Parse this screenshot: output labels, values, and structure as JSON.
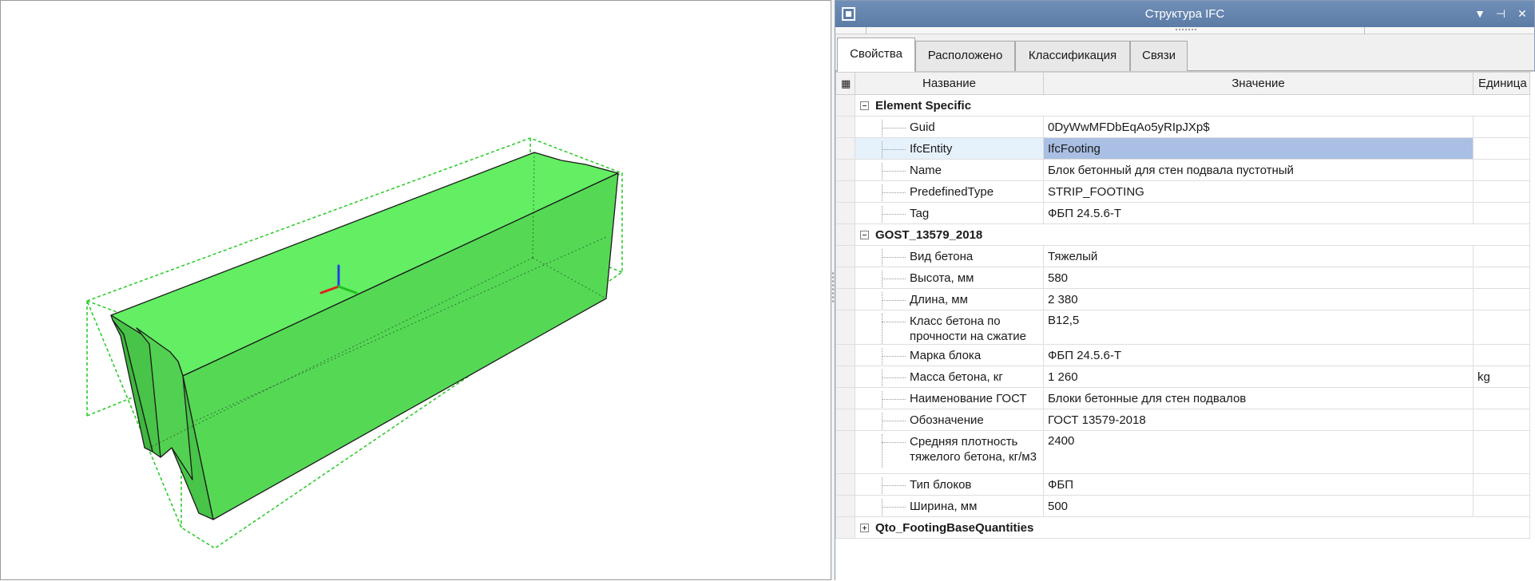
{
  "panel": {
    "title": "Структура IFC",
    "tabs": [
      "Свойства",
      "Расположено",
      "Классификация",
      "Связи"
    ],
    "active_tab": 0
  },
  "grid": {
    "columns": {
      "name": "Название",
      "value": "Значение",
      "unit": "Единица"
    },
    "groups": [
      {
        "name": "Element Specific",
        "expanded": true,
        "rows": [
          {
            "name": "Guid",
            "value": "0DyWwMFDbEqAo5yRIpJXp$",
            "unit": ""
          },
          {
            "name": "IfcEntity",
            "value": "IfcFooting",
            "unit": "",
            "selected": true
          },
          {
            "name": "Name",
            "value": "Блок бетонный для стен подвала пустотный",
            "unit": ""
          },
          {
            "name": "PredefinedType",
            "value": "STRIP_FOOTING",
            "unit": ""
          },
          {
            "name": "Tag",
            "value": "ФБП 24.5.6-Т",
            "unit": ""
          }
        ]
      },
      {
        "name": "GOST_13579_2018",
        "expanded": true,
        "rows": [
          {
            "name": "Вид бетона",
            "value": "Тяжелый",
            "unit": ""
          },
          {
            "name": "Высота, мм",
            "value": "580",
            "unit": ""
          },
          {
            "name": "Длина, мм",
            "value": "2 380",
            "unit": ""
          },
          {
            "name": "Класс бетона по прочности на сжатие",
            "value": "В12,5",
            "unit": ""
          },
          {
            "name": "Марка блока",
            "value": "ФБП 24.5.6-Т",
            "unit": ""
          },
          {
            "name": "Масса бетона, кг",
            "value": "1 260",
            "unit": "kg"
          },
          {
            "name": "Наименование ГОСТ",
            "value": "Блоки бетонные для стен подвалов",
            "unit": ""
          },
          {
            "name": "Обозначение",
            "value": "ГОСТ 13579-2018",
            "unit": ""
          },
          {
            "name": "Средняя плотность тяжелого бетона, кг/м3",
            "value": "2400",
            "unit": ""
          },
          {
            "name": "Тип блоков",
            "value": "ФБП",
            "unit": ""
          },
          {
            "name": "Ширина, мм",
            "value": "500",
            "unit": ""
          }
        ]
      },
      {
        "name": "Qto_FootingBaseQuantities",
        "expanded": false,
        "rows": []
      }
    ]
  },
  "viewport": {
    "object_color": "#5ce65c",
    "bbox_color": "#2ecc2e",
    "axis_colors": {
      "x": "#e02020",
      "y": "#20c020",
      "z": "#2040e0"
    }
  }
}
